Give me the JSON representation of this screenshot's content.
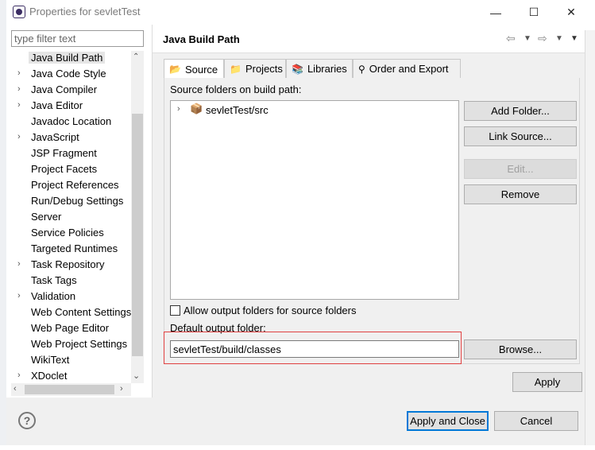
{
  "window": {
    "title": "Properties for sevletTest",
    "minimize": "—",
    "maximize": "☐",
    "close": "✕"
  },
  "filter": {
    "placeholder": "type filter text"
  },
  "tree": [
    {
      "label": "Java Build Path",
      "expandable": false,
      "selected": true
    },
    {
      "label": "Java Code Style",
      "expandable": true
    },
    {
      "label": "Java Compiler",
      "expandable": true
    },
    {
      "label": "Java Editor",
      "expandable": true
    },
    {
      "label": "Javadoc Location",
      "expandable": false
    },
    {
      "label": "JavaScript",
      "expandable": true
    },
    {
      "label": "JSP Fragment",
      "expandable": false
    },
    {
      "label": "Project Facets",
      "expandable": false
    },
    {
      "label": "Project References",
      "expandable": false
    },
    {
      "label": "Run/Debug Settings",
      "expandable": false
    },
    {
      "label": "Server",
      "expandable": false
    },
    {
      "label": "Service Policies",
      "expandable": false
    },
    {
      "label": "Targeted Runtimes",
      "expandable": false
    },
    {
      "label": "Task Repository",
      "expandable": true
    },
    {
      "label": "Task Tags",
      "expandable": false
    },
    {
      "label": "Validation",
      "expandable": true
    },
    {
      "label": "Web Content Settings",
      "expandable": false
    },
    {
      "label": "Web Page Editor",
      "expandable": false
    },
    {
      "label": "Web Project Settings",
      "expandable": false
    },
    {
      "label": "WikiText",
      "expandable": false
    },
    {
      "label": "XDoclet",
      "expandable": true
    }
  ],
  "page": {
    "title": "Java Build Path"
  },
  "tabs": [
    {
      "label": "Source",
      "active": true
    },
    {
      "label": "Projects"
    },
    {
      "label": "Libraries"
    },
    {
      "label": "Order and Export"
    }
  ],
  "source": {
    "heading": "Source folders on build path:",
    "folders": [
      "sevletTest/src"
    ],
    "buttons": {
      "add_folder": "Add Folder...",
      "link_source": "Link Source...",
      "edit": "Edit...",
      "remove": "Remove"
    },
    "allow_output_label": "Allow output folders for source folders",
    "default_output_label": "Default output folder:",
    "default_output_value": "sevletTest/build/classes",
    "browse": "Browse..."
  },
  "apply": "Apply",
  "footer": {
    "help": "?",
    "apply_close": "Apply and Close",
    "cancel": "Cancel"
  },
  "colors": {
    "accent": "#0078d7",
    "highlight_box": "#e04040"
  }
}
